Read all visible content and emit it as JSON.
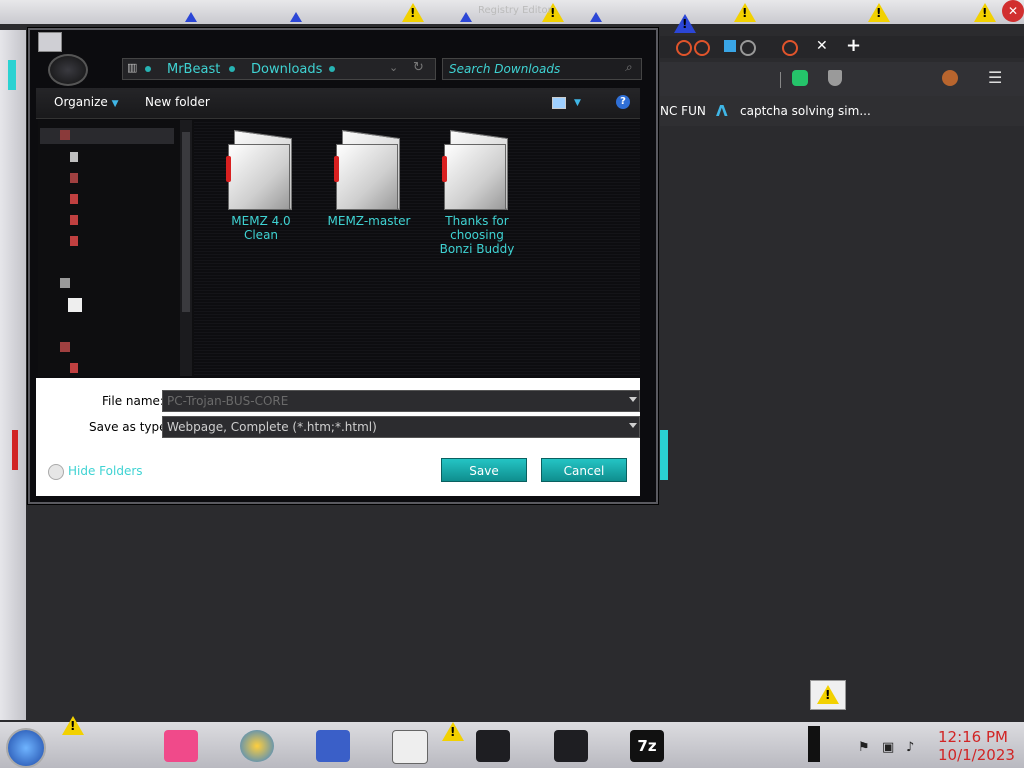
{
  "desktop": {
    "top_window_title": "Registry Editor"
  },
  "browser": {
    "bookmarks": [
      {
        "label": "NC FUN"
      },
      {
        "label": "captcha solving sim..."
      }
    ]
  },
  "dialog": {
    "breadcrumb": [
      "MrBeast",
      "Downloads"
    ],
    "search_placeholder": "Search Downloads",
    "toolbar": {
      "organize": "Organize",
      "new_folder": "New folder"
    },
    "files": [
      {
        "name": "MEMZ 4.0 Clean"
      },
      {
        "name": "MEMZ-master"
      },
      {
        "name": "Thanks for choosing Bonzi Buddy"
      }
    ],
    "file_name_label": "File name:",
    "file_name_value": "PC-Trojan-BUS-CORE",
    "save_type_label": "Save as type:",
    "save_type_value": "Webpage, Complete (*.htm;*.html)",
    "hide_folders": "Hide Folders",
    "save_label": "Save",
    "cancel_label": "Cancel"
  },
  "taskbar": {
    "time": "12:16 PM",
    "date": "10/1/2023"
  },
  "colors": {
    "accent": "#3fd3d3",
    "button": "#17a9a9",
    "clock": "#d12525",
    "warning": "#f2d100"
  }
}
